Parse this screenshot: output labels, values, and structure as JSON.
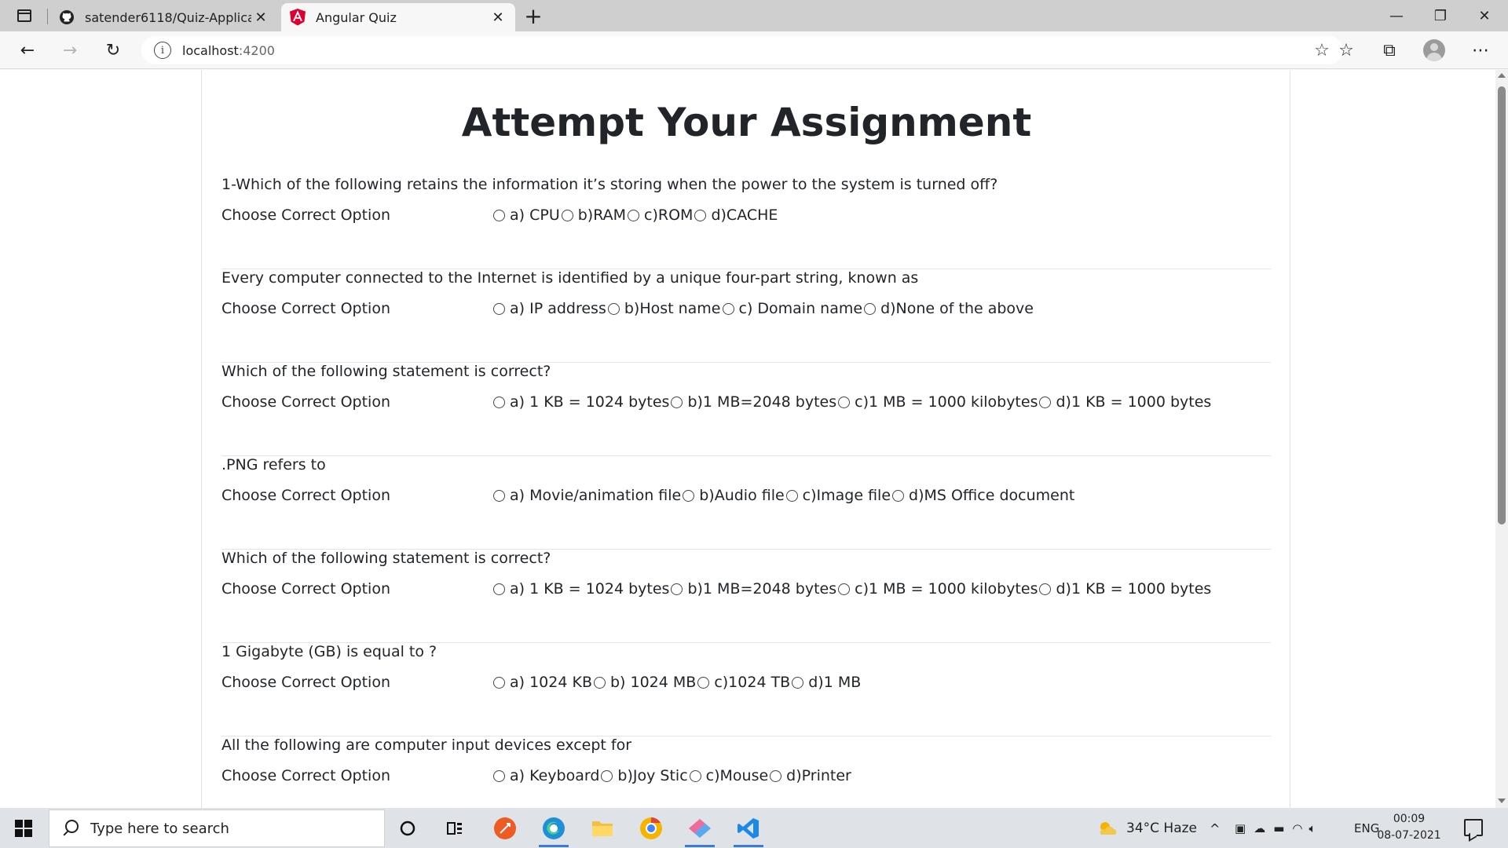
{
  "browser": {
    "tabs": [
      {
        "title": "satender6118/Quiz-Application:",
        "favicon": "github-icon",
        "active": false
      },
      {
        "title": "Angular Quiz",
        "favicon": "angular-icon",
        "active": true
      }
    ],
    "address": {
      "host": "localhost",
      "port": ":4200"
    }
  },
  "page": {
    "title": "Attempt Your Assignment",
    "questions": [
      {
        "text": "1-Which of the following retains the information it’s storing when the power to the system is turned off?",
        "label": "Choose Correct Option",
        "options": [
          "a) CPU",
          "b)RAM",
          "c)ROM",
          "d)CACHE"
        ]
      },
      {
        "text": "Every computer connected to the Internet is identified by a unique four-part string, known as",
        "label": "Choose Correct Option",
        "options": [
          "a) IP address",
          "b)Host name",
          "c) Domain name",
          "d)None of the above"
        ]
      },
      {
        "text": "Which of the following statement is correct?",
        "label": "Choose Correct Option",
        "options": [
          "a) 1 KB = 1024 bytes",
          "b)1 MB=2048 bytes",
          "c)1 MB = 1000 kilobytes",
          "d)1 KB = 1000 bytes"
        ]
      },
      {
        "text": ".PNG refers to",
        "label": "Choose Correct Option",
        "options": [
          "a) Movie/animation file",
          "b)Audio file",
          "c)Image file",
          "d)MS Office document"
        ]
      },
      {
        "text": "Which of the following statement is correct?",
        "label": "Choose Correct Option",
        "options": [
          "a) 1 KB = 1024 bytes",
          "b)1 MB=2048 bytes",
          "c)1 MB = 1000 kilobytes",
          "d)1 KB = 1000 bytes"
        ]
      },
      {
        "text": "1 Gigabyte (GB) is equal to ?",
        "label": "Choose Correct Option",
        "options": [
          "a) 1024 KB",
          "b) 1024 MB",
          "c)1024 TB",
          "d)1 MB"
        ]
      },
      {
        "text": "All the following are computer input devices except for",
        "label": "Choose Correct Option",
        "options": [
          "a) Keyboard",
          "b)Joy Stic",
          "c)Mouse",
          "d)Printer"
        ]
      }
    ]
  },
  "taskbar": {
    "search_placeholder": "Type here to search",
    "weather": "34°C  Haze",
    "language": "ENG",
    "time": "00:09",
    "date": "08-07-2021"
  },
  "colors": {
    "accent": "#3b7bd8",
    "angular_red": "#dd0031",
    "text": "#212529"
  }
}
